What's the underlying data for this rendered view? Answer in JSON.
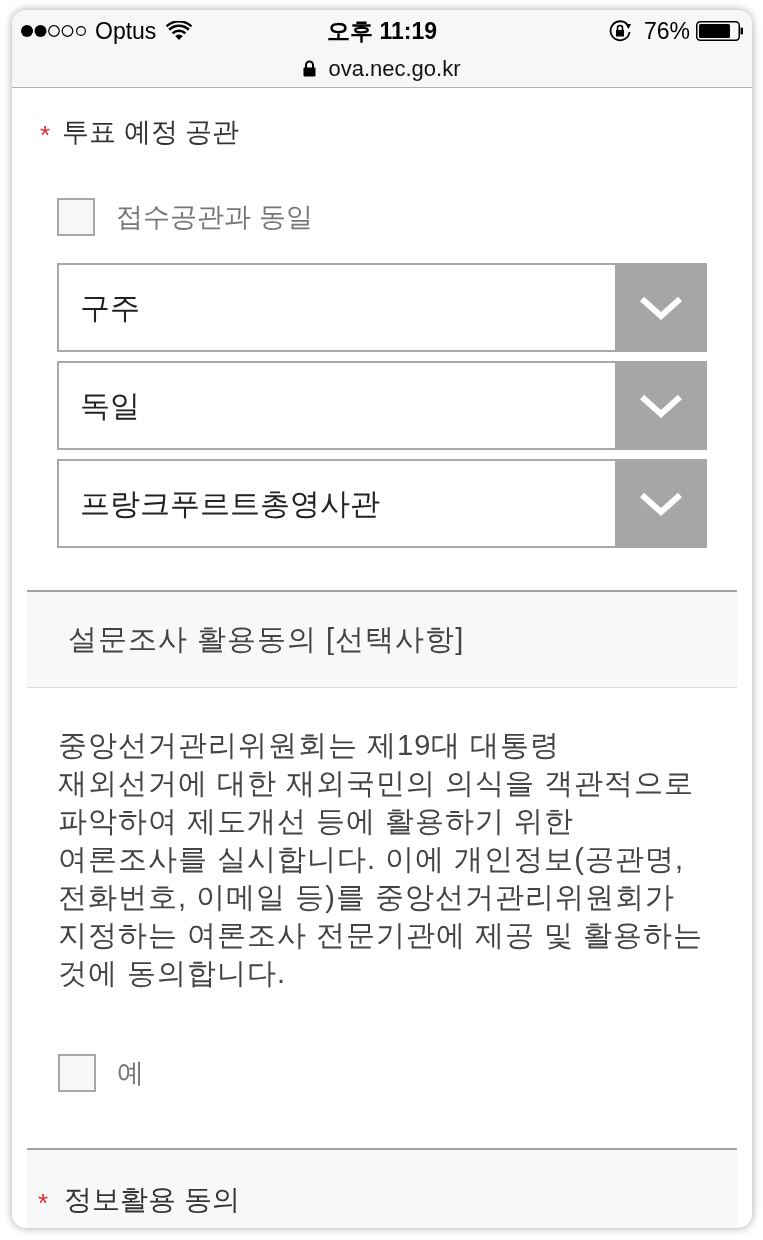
{
  "status_bar": {
    "carrier": "Optus",
    "time": "오후 11:19",
    "battery": "76%"
  },
  "address_bar": {
    "url": "ova.nec.go.kr"
  },
  "polling_place": {
    "required_mark": "*",
    "title": "투표 예정 공관",
    "same_as_checkbox": {
      "label": "접수공관과 동일",
      "checked": false
    },
    "dropdowns": [
      {
        "value": "구주"
      },
      {
        "value": "독일"
      },
      {
        "value": "프랑크푸르트총영사관"
      }
    ]
  },
  "survey_consent": {
    "title": "설문조사 활용동의 [선택사항]",
    "text_lines": [
      "중앙선거관리위원회는 제19대 대통령",
      "재외선거에 대한 재외국민의 의식을 객관적으로",
      "파악하여 제도개선 등에 활용하기 위한",
      "여론조사를 실시합니다. 이에 개인정보(공관명,",
      "전화번호, 이메일 등)를 중앙선거관리위원회가",
      "지정하는 여론조사 전문기관에 제공 및 활용하는",
      "것에 동의합니다."
    ],
    "checkbox": {
      "label": "예",
      "checked": false
    }
  },
  "info_consent": {
    "required_mark": "*",
    "title": "정보활용 동의"
  }
}
